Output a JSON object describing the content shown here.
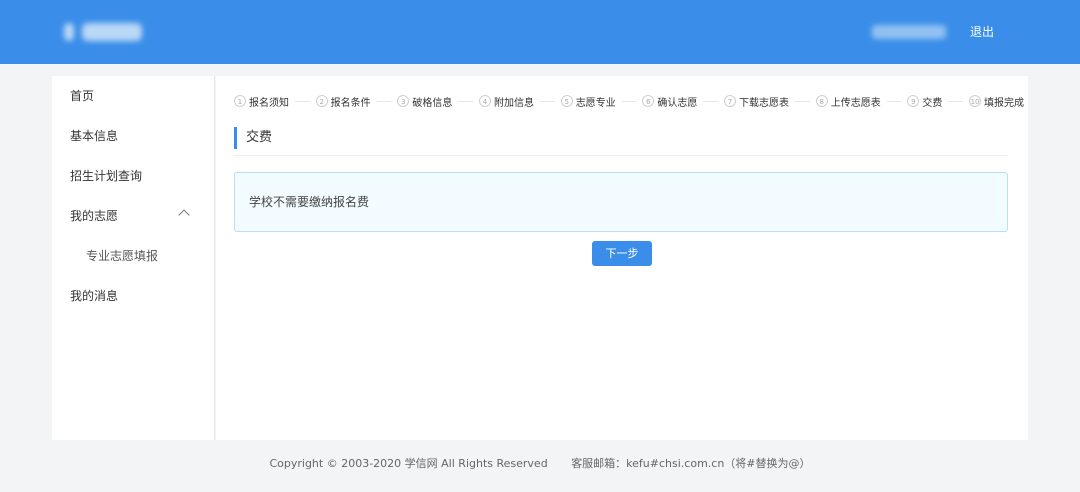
{
  "header": {
    "logout_label": "退出",
    "accent_color": "#3a8ee9"
  },
  "sidebar": {
    "items": [
      {
        "label": "首页"
      },
      {
        "label": "基本信息"
      },
      {
        "label": "招生计划查询"
      },
      {
        "label": "我的志愿",
        "expanded": true
      },
      {
        "label": "专业志愿填报",
        "sub": true
      },
      {
        "label": "我的消息"
      }
    ]
  },
  "steps": [
    {
      "num": "1",
      "label": "报名须知"
    },
    {
      "num": "2",
      "label": "报名条件"
    },
    {
      "num": "3",
      "label": "破格信息"
    },
    {
      "num": "4",
      "label": "附加信息"
    },
    {
      "num": "5",
      "label": "志愿专业"
    },
    {
      "num": "6",
      "label": "确认志愿"
    },
    {
      "num": "7",
      "label": "下载志愿表"
    },
    {
      "num": "8",
      "label": "上传志愿表"
    },
    {
      "num": "9",
      "label": "交费"
    },
    {
      "num": "10",
      "label": "填报完成"
    }
  ],
  "main": {
    "section_title": "交费",
    "notice_text": "学校不需要缴纳报名费",
    "next_button_label": "下一步"
  },
  "footer": {
    "copyright": "Copyright © 2003-2020 学信网 All Rights Reserved",
    "service_email": "客服邮箱：kefu#chsi.com.cn（将#替换为@）"
  }
}
